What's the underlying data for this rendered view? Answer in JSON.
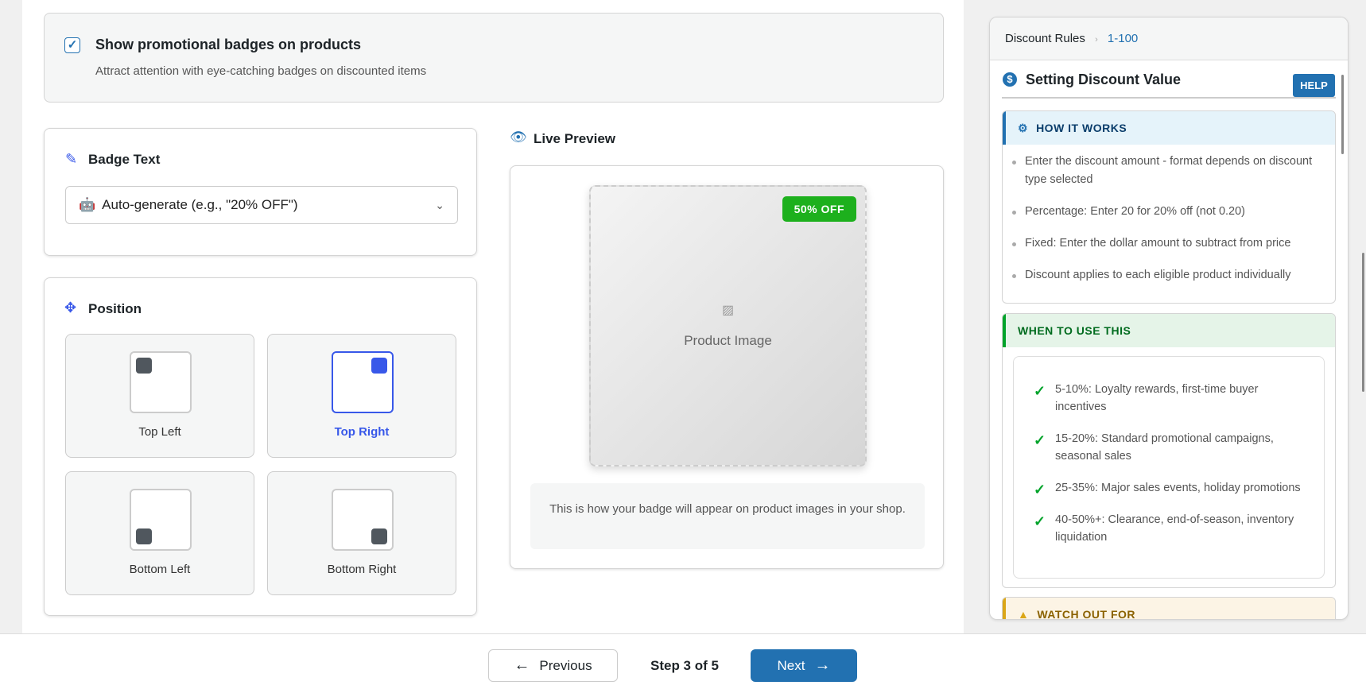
{
  "promo": {
    "checked": true,
    "title": "Show promotional badges on products",
    "desc": "Attract attention with eye-catching badges on discounted items"
  },
  "badge_text": {
    "title": "Badge Text",
    "selected": "Auto-generate (e.g., \"20% OFF\")"
  },
  "position": {
    "title": "Position",
    "options": [
      {
        "label": "Top Left",
        "selected": false
      },
      {
        "label": "Top Right",
        "selected": true
      },
      {
        "label": "Bottom Left",
        "selected": false
      },
      {
        "label": "Bottom Right",
        "selected": false
      }
    ]
  },
  "preview": {
    "title": "Live Preview",
    "badge": "50% OFF",
    "image_label": "Product Image",
    "caption": "This is how your badge will appear on product images in your shop.",
    "badge_color": "#1db01d"
  },
  "help": {
    "breadcrumb": [
      "Discount Rules",
      "1-100"
    ],
    "title": "Setting Discount Value",
    "help_button": "HELP",
    "how": {
      "title": "HOW IT WORKS",
      "items": [
        "Enter the discount amount - format depends on discount type selected",
        "Percentage: Enter 20 for 20% off (not 0.20)",
        "Fixed: Enter the dollar amount to subtract from price",
        "Discount applies to each eligible product individually"
      ]
    },
    "when": {
      "title": "WHEN TO USE THIS",
      "items": [
        "5-10%: Loyalty rewards, first-time buyer incentives",
        "15-20%: Standard promotional campaigns, seasonal sales",
        "25-35%: Major sales events, holiday promotions",
        "40-50%+: Clearance, end-of-season, inventory liquidation"
      ]
    },
    "watch": {
      "title": "WATCH OUT FOR"
    }
  },
  "footer": {
    "previous": "Previous",
    "step": "Step 3 of 5",
    "next": "Next"
  },
  "colors": {
    "accent": "#2271b1",
    "selected": "#3858e9"
  }
}
